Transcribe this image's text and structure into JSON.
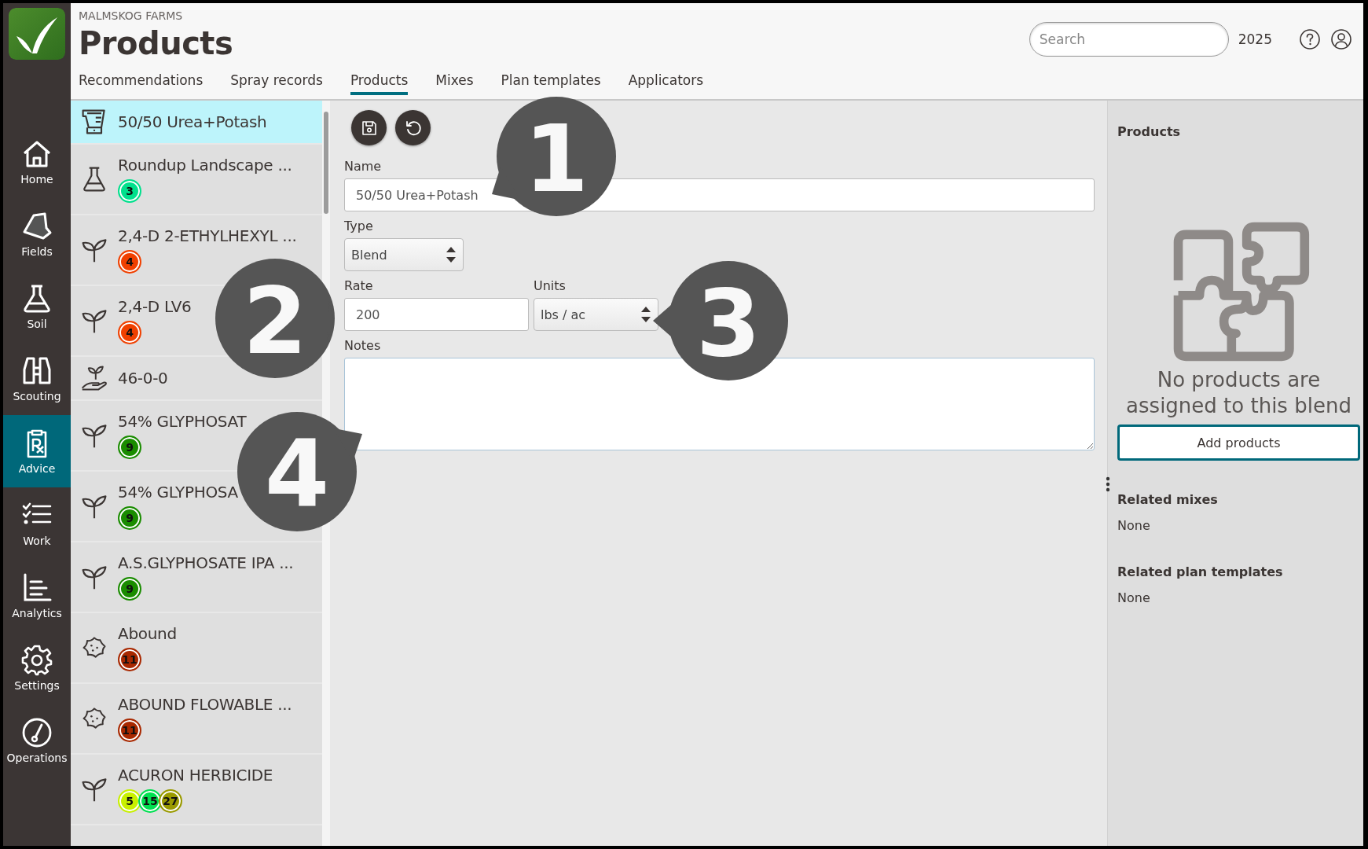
{
  "app": {
    "org": "MALMSKOG FARMS",
    "title": "Products"
  },
  "search": {
    "placeholder": "Search"
  },
  "year": "2025",
  "nav": [
    {
      "label": "Home",
      "kind": "home",
      "selected": false
    },
    {
      "label": "Fields",
      "kind": "field",
      "selected": false
    },
    {
      "label": "Soil",
      "kind": "flask",
      "selected": false
    },
    {
      "label": "Scouting",
      "kind": "binoculars",
      "selected": false
    },
    {
      "label": "Advice",
      "kind": "rx",
      "selected": true
    },
    {
      "label": "Work",
      "kind": "checklist",
      "selected": false
    },
    {
      "label": "Analytics",
      "kind": "chart",
      "selected": false
    },
    {
      "label": "Settings",
      "kind": "gear",
      "selected": false
    },
    {
      "label": "Operations",
      "kind": "gauge",
      "selected": false
    }
  ],
  "tabs": [
    {
      "label": "Recommendations",
      "selected": false
    },
    {
      "label": "Spray records",
      "selected": false
    },
    {
      "label": "Products",
      "selected": true
    },
    {
      "label": "Mixes",
      "selected": false
    },
    {
      "label": "Plan templates",
      "selected": false
    },
    {
      "label": "Applicators",
      "selected": false
    }
  ],
  "products": [
    {
      "name": "50/50 Urea+Potash",
      "kind": "blend",
      "selected": true
    },
    {
      "name": "Roundup Landscape ...",
      "kind": "flask",
      "selected": false,
      "badges": [
        {
          "text": "3",
          "color": "#00e08c"
        }
      ]
    },
    {
      "name": "2,4-D 2-ETHYLHEXYL ...",
      "kind": "sprout",
      "selected": false,
      "badges": [
        {
          "text": "4",
          "color": "#f04000"
        }
      ]
    },
    {
      "name": "2,4-D LV6",
      "kind": "sprout",
      "selected": false,
      "badges": [
        {
          "text": "4",
          "color": "#f04000"
        }
      ]
    },
    {
      "name": "46-0-0",
      "kind": "hand",
      "selected": false
    },
    {
      "name": "54% GLYPHOSAT",
      "kind": "sprout",
      "selected": false,
      "badges": [
        {
          "text": "9",
          "color": "#1a8c00"
        }
      ]
    },
    {
      "name": "54% GLYPHOSA",
      "kind": "sprout",
      "selected": false,
      "badges": [
        {
          "text": "9",
          "color": "#1a8c00"
        }
      ]
    },
    {
      "name": "A.S.GLYPHOSATE IPA ...",
      "kind": "sprout",
      "selected": false,
      "badges": [
        {
          "text": "9",
          "color": "#1a8c00"
        }
      ]
    },
    {
      "name": "Abound",
      "kind": "microbe",
      "selected": false,
      "badges": [
        {
          "text": "11",
          "color": "#a82800"
        }
      ]
    },
    {
      "name": "ABOUND FLOWABLE ...",
      "kind": "microbe",
      "selected": false,
      "badges": [
        {
          "text": "11",
          "color": "#a82800"
        }
      ]
    },
    {
      "name": "ACURON HERBICIDE",
      "kind": "sprout",
      "selected": false,
      "badges": [
        {
          "text": "5",
          "color": "#c8f000"
        },
        {
          "text": "15",
          "color": "#00e050"
        },
        {
          "text": "27",
          "color": "#9a9a00"
        }
      ]
    }
  ],
  "form": {
    "name_label": "Name",
    "name_value": "50/50 Urea+Potash",
    "type_label": "Type",
    "type_value": "Blend",
    "rate_label": "Rate",
    "rate_value": "200",
    "units_label": "Units",
    "units_value": "lbs / ac",
    "notes_label": "Notes"
  },
  "side_panel": {
    "title": "Products",
    "empty_message": "No products are assigned to this blend",
    "add_button": "Add products",
    "sections": [
      {
        "title": "Related mixes",
        "value": "None"
      },
      {
        "title": "Related plan templates",
        "value": "None"
      }
    ]
  },
  "callouts": [
    {
      "text": "1"
    },
    {
      "text": "2"
    },
    {
      "text": "3"
    },
    {
      "text": "4"
    }
  ]
}
